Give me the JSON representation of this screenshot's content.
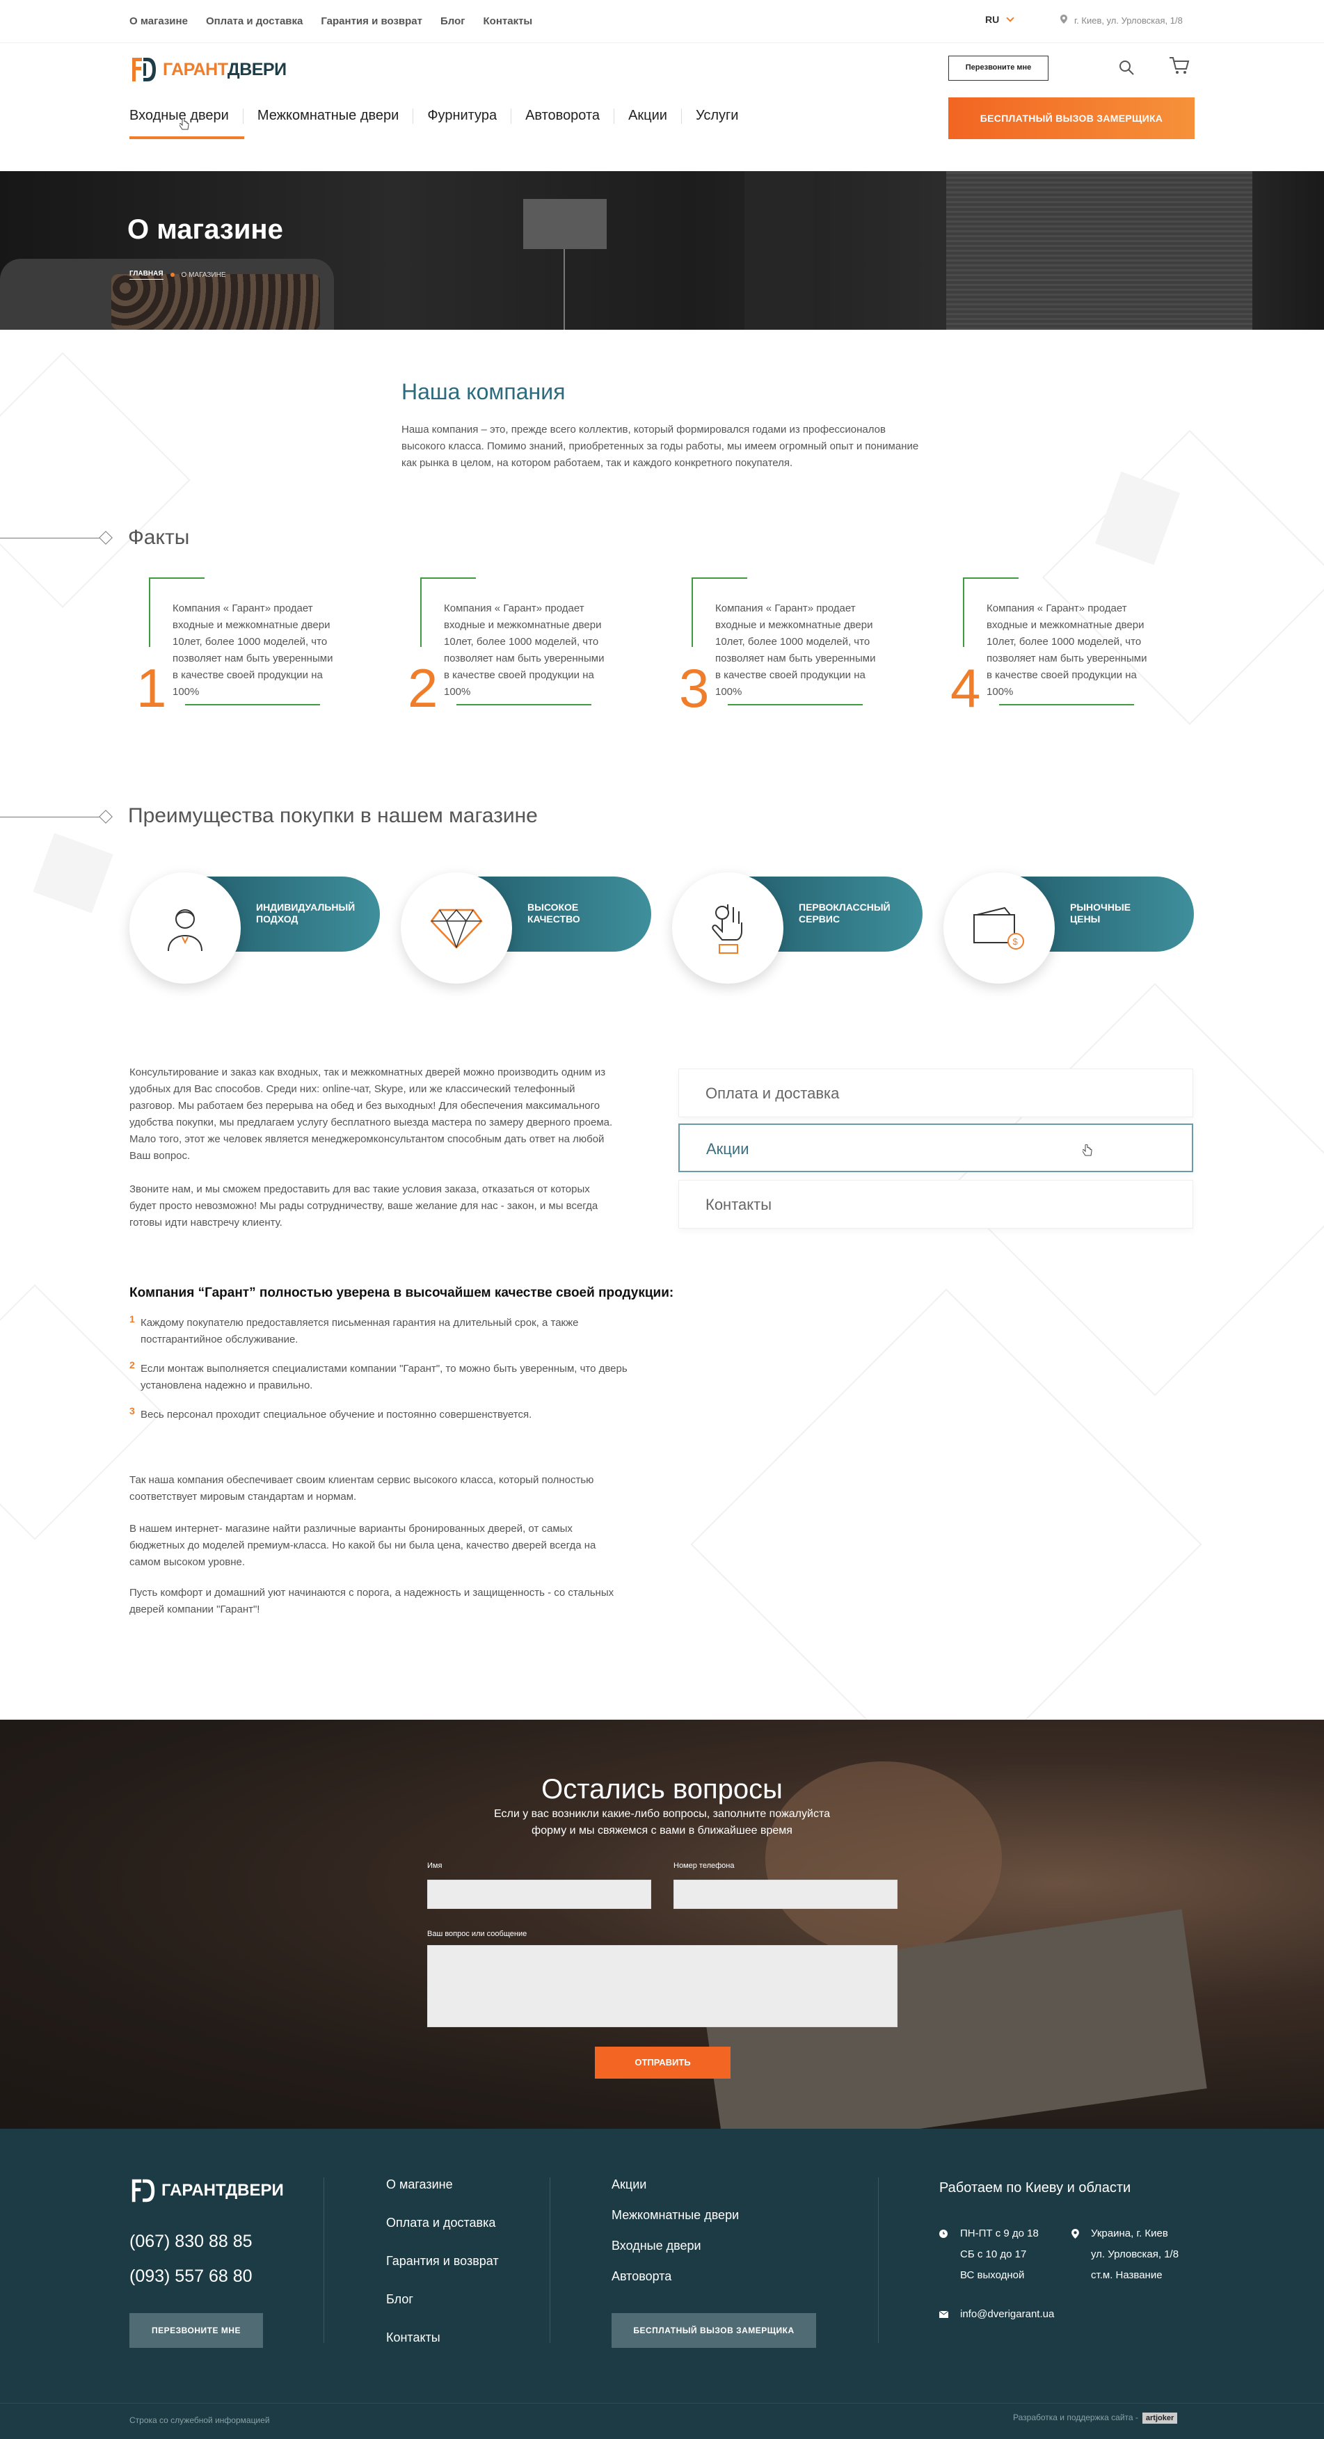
{
  "topbar": {
    "links": [
      "О магазине",
      "Оплата и доставка",
      "Гарантия и возврат",
      "Блог",
      "Контакты"
    ],
    "lang": "RU",
    "address": "г. Киев, ул. Урловская, 1/8"
  },
  "header": {
    "logo_part1": "ГАРАНТ",
    "logo_part2": "ДВЕРИ",
    "callme": "Перезвоните мне",
    "nav": [
      "Входные двери",
      "Межкомнатные двери",
      "Фурнитура",
      "Автоворота",
      "Акции",
      "Услуги"
    ],
    "cta": "БЕСПЛАТНЫЙ ВЫЗОВ ЗАМЕРЩИКА"
  },
  "hero": {
    "title": "О магазине",
    "crumb_home": "ГЛАВНАЯ",
    "crumb_current": "О МАГАЗИНЕ"
  },
  "company": {
    "title": "Наша компания",
    "text": "Наша компания – это, прежде всего коллектив, который формировался годами из профессионалов высокого класса. Помимо знаний, приобретенных за годы работы, мы  имеем огромный опыт и понимание как рынка в целом, на котором работаем, так и  каждого конкретного покупателя."
  },
  "facts": {
    "title": "Факты",
    "items": [
      {
        "num": "1",
        "text": "Компания « Гарант» продает входные и межкомнатные двери 10лет, более 1000  моделей, что позволяет нам быть уверенными в качестве своей продукции на 100%"
      },
      {
        "num": "2",
        "text": "Компания « Гарант» продает входные и межкомнатные двери 10лет, более 1000  моделей, что позволяет нам быть уверенными в качестве своей продукции на 100%"
      },
      {
        "num": "3",
        "text": "Компания « Гарант» продает входные и межкомнатные двери 10лет, более 1000  моделей, что позволяет нам быть уверенными в качестве своей продукции на 100%"
      },
      {
        "num": "4",
        "text": "Компания « Гарант» продает входные и межкомнатные двери 10лет, более 1000  моделей, что позволяет нам быть уверенными в качестве своей продукции на 100%"
      }
    ]
  },
  "advantages": {
    "title": "Преимущества покупки в нашем магазине",
    "items": [
      {
        "line1": "ИНДИВИДУАЛЬНЫЙ",
        "line2": "ПОДХОД",
        "icon": "person-icon"
      },
      {
        "line1": "ВЫСОКОЕ",
        "line2": "КАЧЕСТВО",
        "icon": "diamond-icon"
      },
      {
        "line1": "ПЕРВОКЛАССНЫЙ",
        "line2": "СЕРВИС",
        "icon": "ok-hand-icon"
      },
      {
        "line1": "РЫНОЧНЫЕ",
        "line2": "ЦЕНЫ",
        "icon": "wallet-icon"
      }
    ]
  },
  "info": {
    "para1": "Консультирование и заказ как входных, так и межкомнатных дверей можно производить одним из удобных для Вас способов. Среди них: online-чат, Skype, или же классический телефонный разговор. Мы работаем без перерыва на обед и без выходных! Для обеспечения максимального удобства покупки, мы предлагаем услугу бесплатного выезда мастера по замеру дверного проема. Мало того, этот же человек является менеджеромконсультантом способным дать ответ на любой Ваш вопрос.",
    "para2": "Звоните нам, и мы сможем предоставить для вас такие условия заказа, отказаться от которых будет просто невозможно! Мы рады сотрудничеству, ваше желание для нас - закон, и мы всегда готовы идти навстречу клиенту.",
    "tabs": [
      "Оплата и доставка",
      "Акции",
      "Контакты"
    ],
    "quality_title": "Компания “Гарант” полностью уверена в высочайшем качестве своей продукции:",
    "list": [
      {
        "n": "1",
        "text": "Каждому покупателю предоставляется письменная гарантия на длительный срок, а также постгарантийное обслуживание."
      },
      {
        "n": "2",
        "text": "Если монтаж выполняется специалистами компании \"Гарант\", то можно быть  уверенным, что дверь установлена надежно и правильно."
      },
      {
        "n": "3",
        "text": "Весь персонал проходит специальное обучение и постоянно совершенствуется."
      }
    ],
    "para3": "Так наша компания обеспечивает своим клиентам сервис высокого класса, который полностью соответствует мировым стандартам и нормам.",
    "para4": "В нашем интернет- магазине найти различные варианты бронированных дверей, от самых бюджетных до моделей премиум-класса. Но какой бы ни была цена, качество дверей всегда на самом высоком уровне.",
    "para5": "Пусть комфорт и домашний уют начинаются с порога, а надежность и защищенность - со стальных дверей компании \"Гарант\"!"
  },
  "questions": {
    "title": "Остались вопросы",
    "sub1": "Если у вас возникли какие-либо вопросы, заполните пожалуйста",
    "sub2": "форму и мы свяжемся с вами в ближайшее время",
    "name_label": "Имя",
    "phone_label": "Номер телефона",
    "message_label": "Ваш вопрос или сообщение",
    "name_value": "",
    "phone_value": "",
    "message_value": "",
    "send": "ОТПРАВИТЬ"
  },
  "footer": {
    "logo_part1": "ГАРАНТ",
    "logo_part2": "ДВЕРИ",
    "phone1": "(067) 830 88 85",
    "phone2": "(093) 557 68 80",
    "callme": "ПЕРЕЗВОНИТЕ МНЕ",
    "col1": [
      "О магазине",
      "Оплата и доставка",
      "Гарантия и возврат",
      "Блог",
      "Контакты"
    ],
    "col2": [
      "Акции",
      "Межкомнатные двери",
      "Входные двери",
      "Автоворта"
    ],
    "cta": "БЕСПЛАТНЫЙ ВЫЗОВ ЗАМЕРЩИКА",
    "region_title": "Работаем по Киеву и области",
    "hours1": "ПН-ПТ с 9 до 18",
    "hours2": "СБ с 10 до 17",
    "hours3": "ВС выходной",
    "addr1": "Украина, г. Киев",
    "addr2": "ул. Урловская, 1/8",
    "addr3": "ст.м. Название",
    "email": "info@dverigarant.ua",
    "service_line": "Строка со служебной информацией",
    "dev": "Разработка и поддержка сайта -",
    "dev_badge": "artjoker"
  },
  "colors": {
    "accent": "#f07d2a",
    "teal": "#2c6a7d",
    "footer_bg": "#1c3b45",
    "green": "#3e9b3e"
  }
}
